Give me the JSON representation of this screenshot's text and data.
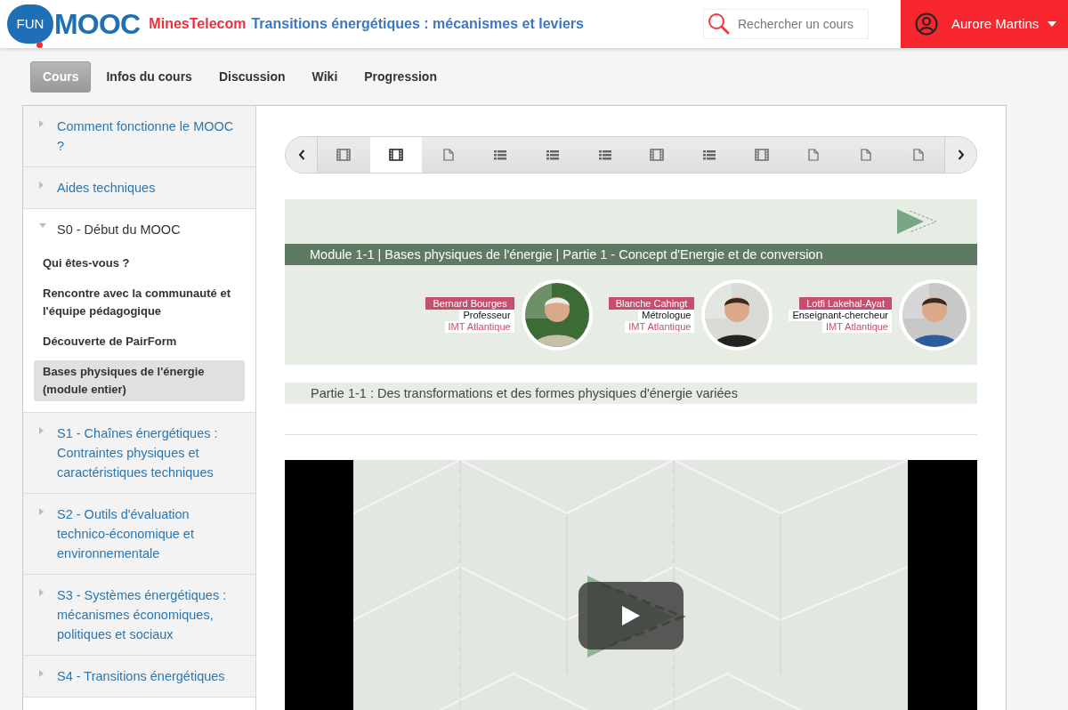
{
  "header": {
    "logo": {
      "left": "FUN",
      "right": "MOOC"
    },
    "org": "MinesTelecom",
    "course_title": "Transitions énergétiques : mécanismes et leviers",
    "search": {
      "placeholder": "Rechercher un cours"
    },
    "user": {
      "name": "Aurore Martins"
    }
  },
  "tabs": [
    {
      "label": "Cours",
      "selected": true
    },
    {
      "label": "Infos du cours",
      "selected": false
    },
    {
      "label": "Discussion",
      "selected": false
    },
    {
      "label": "Wiki",
      "selected": false
    },
    {
      "label": "Progression",
      "selected": false
    }
  ],
  "sidebar": {
    "sections": [
      {
        "title": "Comment fonctionne le MOOC ?",
        "expanded": false
      },
      {
        "title": "Aides techniques",
        "expanded": false
      },
      {
        "title": "S0 - Début du MOOC",
        "expanded": true,
        "children": [
          {
            "label": "Qui êtes-vous ?",
            "selected": false
          },
          {
            "label": "Rencontre avec la communauté et l'équipe pédagogique",
            "selected": false
          },
          {
            "label": "Découverte de PairForm",
            "selected": false
          },
          {
            "label": "Bases physiques de l'énergie (module entier)",
            "selected": true
          }
        ]
      },
      {
        "title": "S1 - Chaînes énergétiques : Contraintes physiques et caractéristiques techniques",
        "expanded": false
      },
      {
        "title": "S2 - Outils d'évaluation technico-économique et environnementale",
        "expanded": false
      },
      {
        "title": "S3 - Systèmes énergétiques : mécanismes économiques, politiques et sociaux",
        "expanded": false
      },
      {
        "title": "S4 - Transitions énergétiques",
        "expanded": false
      }
    ]
  },
  "sequence_nav": {
    "items": [
      {
        "kind": "video",
        "selected": false
      },
      {
        "kind": "video",
        "selected": true
      },
      {
        "kind": "problem",
        "selected": false
      },
      {
        "kind": "list",
        "selected": false
      },
      {
        "kind": "list",
        "selected": false
      },
      {
        "kind": "list",
        "selected": false
      },
      {
        "kind": "video",
        "selected": false
      },
      {
        "kind": "list",
        "selected": false
      },
      {
        "kind": "video",
        "selected": false
      },
      {
        "kind": "problem",
        "selected": false
      },
      {
        "kind": "problem",
        "selected": false
      },
      {
        "kind": "problem",
        "selected": false
      }
    ]
  },
  "slide": {
    "title": "Module 1-1 | Bases physiques de l'énergie | Partie 1 - Concept d'Energie et de conversion",
    "speakers": [
      {
        "name": "Bernard Bourges",
        "role": "Professeur",
        "org": "IMT Atlantique"
      },
      {
        "name": "Blanche Cahingt",
        "role": "Métrologue",
        "org": "IMT Atlantique"
      },
      {
        "name": "Lotfi Lakehal-Ayat",
        "role": "Enseignant-chercheur",
        "org": "IMT Atlantique"
      }
    ],
    "subtitle": "Partie 1-1 : Des transformations et des formes physiques d'énergie variées"
  }
}
